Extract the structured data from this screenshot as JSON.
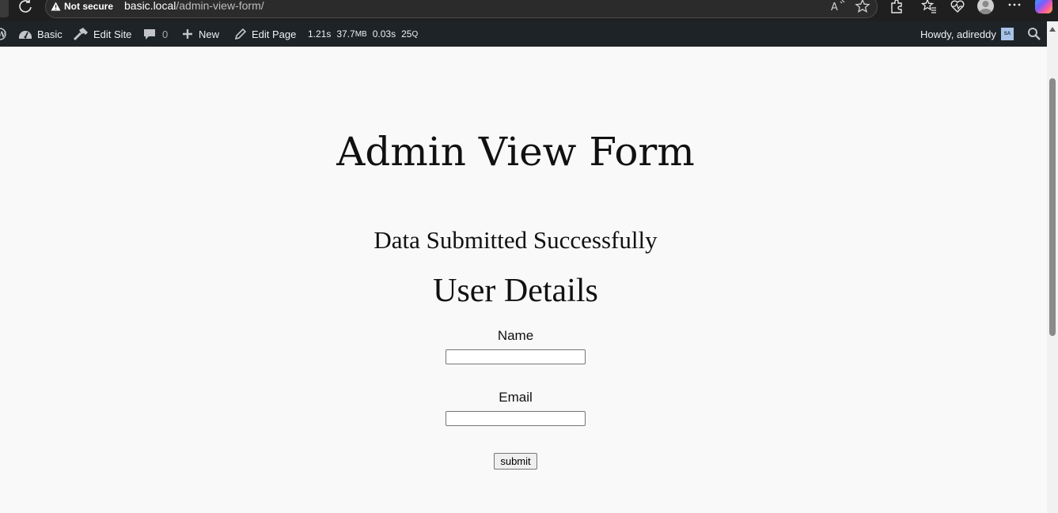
{
  "browser": {
    "security_label": "Not secure",
    "url_host": "basic.local",
    "url_path": "/admin-view-form/"
  },
  "admin_bar": {
    "site_name": "Basic",
    "edit_site": "Edit Site",
    "comments_count": "0",
    "new_label": "New",
    "edit_page": "Edit Page",
    "stat_time": "1.21s",
    "stat_memory": "37.7",
    "stat_memory_unit": "MB",
    "stat_query_time": "0.03s",
    "stat_queries": "25",
    "stat_queries_unit": "Q",
    "howdy": "Howdy, adireddy",
    "avatar_initials": "SA"
  },
  "page": {
    "title": "Admin View Form",
    "success_message": "Data Submitted Successfully",
    "section_title": "User Details",
    "name_label": "Name",
    "name_value": "",
    "email_label": "Email",
    "email_value": "",
    "submit_label": "submit"
  }
}
